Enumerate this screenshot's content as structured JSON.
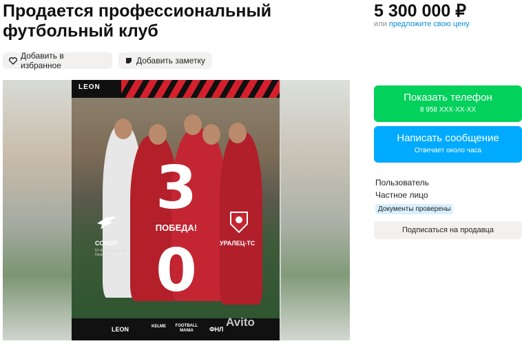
{
  "listing": {
    "title": "Продается профессиональный футбольный клуб",
    "price": "5 300 000 ₽",
    "price_hint_prefix": "или",
    "price_hint_link": "предложите свою цену"
  },
  "actions": {
    "favorite_label": "Добавить в избранное",
    "note_label": "Добавить заметку"
  },
  "image": {
    "brand_top": "LEON",
    "score_home": "3",
    "score_away": "0",
    "result_text": "ПОБЕДА!",
    "team_home": "СОКОЛ",
    "team_home_sub": "57-43' Шевфард 80' Окоматиэ",
    "team_away": "УРАЛЕЦ-ТС",
    "sponsors": [
      "LEON",
      "KELME",
      "FOOTBALL MANIA",
      "ФНЛ"
    ],
    "watermark": "Avito",
    "accent_color": "#d4202c"
  },
  "contact": {
    "phone_label": "Показать телефон",
    "phone_masked": "8 958 XXX-XX-XX",
    "message_label": "Написать сообщение",
    "message_sub": "Отвечает около часа",
    "phone_color": "#02d15c",
    "message_color": "#00aaff"
  },
  "seller": {
    "name": "Пользователь",
    "type": "Частное лицо",
    "badge": "Документы проверены",
    "subscribe_label": "Подписаться на продавца"
  }
}
